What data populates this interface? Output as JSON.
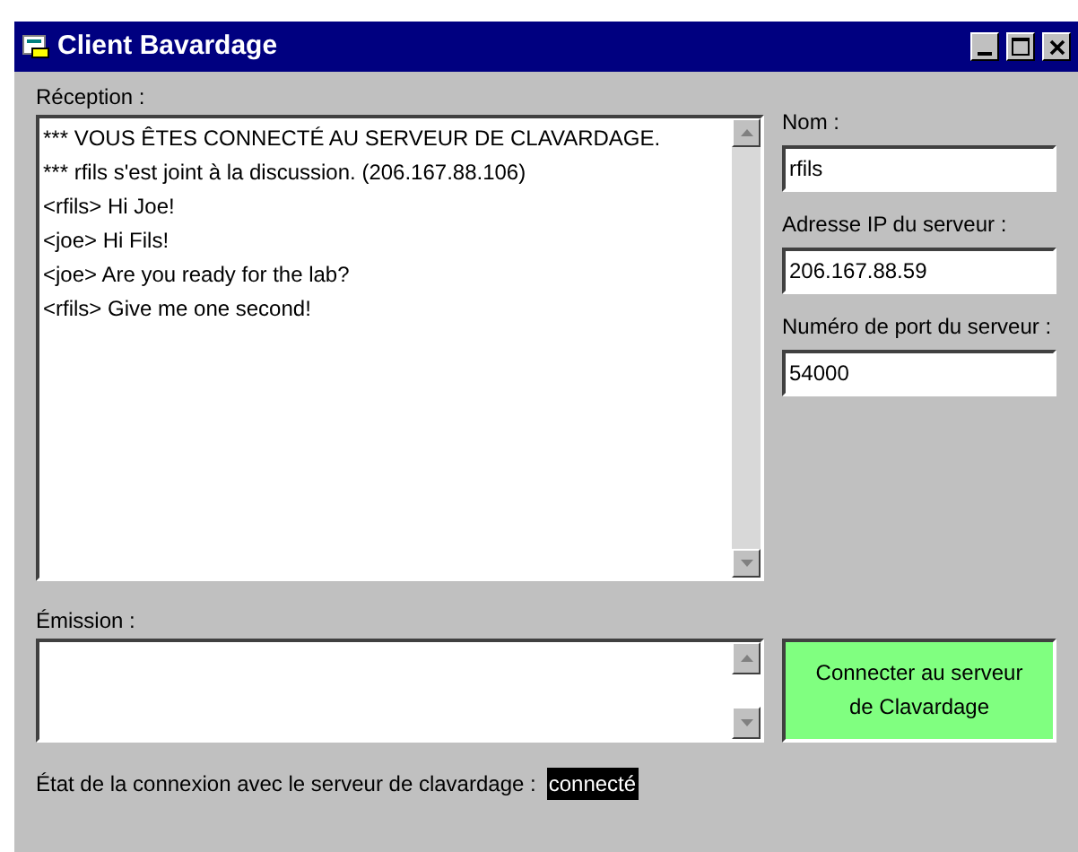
{
  "window": {
    "title": "Client Bavardage"
  },
  "reception": {
    "label": "Réception :",
    "lines": [
      "*** VOUS ÊTES CONNECTÉ AU SERVEUR DE CLAVARDAGE.",
      "*** rfils s'est joint à la discussion. (206.167.88.106)",
      "<rfils> Hi Joe!",
      "<joe> Hi Fils!",
      "<joe> Are you ready for the lab?",
      "<rfils> Give me one second!"
    ]
  },
  "fields": [
    {
      "label": "Nom :",
      "value": "rfils"
    },
    {
      "label": "Adresse IP du serveur :",
      "value": "206.167.88.59"
    },
    {
      "label": "Numéro de port du serveur :",
      "value": "54000"
    }
  ],
  "emission": {
    "label": "Émission :"
  },
  "connect_button": {
    "label": "Connecter au serveur de Clavardage"
  },
  "status": {
    "label": "État de la connexion avec le serveur de clavardage :",
    "value": "connecté"
  }
}
